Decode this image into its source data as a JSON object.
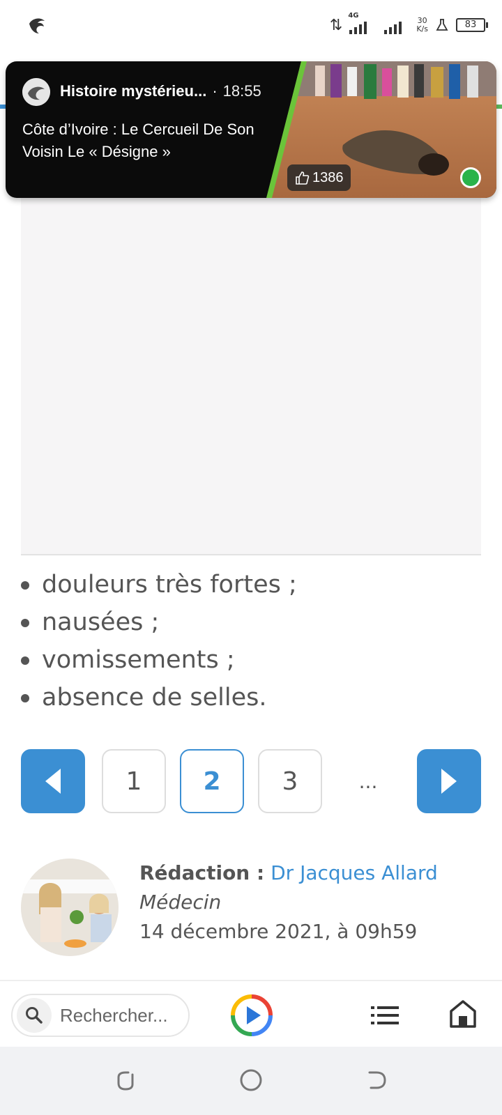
{
  "status_bar": {
    "network_type": "4G",
    "speed_value": "30",
    "speed_unit": "K/s",
    "battery": "83",
    "icons": [
      "app-bird-icon",
      "data-arrows-icon",
      "signal-icon",
      "flask-icon",
      "battery-icon"
    ]
  },
  "notification": {
    "app_name": "Histoire mystérieu...",
    "separator": "·",
    "time": "18:55",
    "message": "Côte d’Ivoire : Le Cercueil De Son Voisin Le « Désigne »",
    "likes": "1386",
    "accent": "#6bc43a"
  },
  "article": {
    "bullets": [
      "douleurs très fortes ;",
      "nausées ;",
      "vomissements ;",
      "absence de selles."
    ]
  },
  "pagination": {
    "pages": [
      "1",
      "2",
      "3"
    ],
    "current": "2",
    "ellipsis": "...",
    "accent": "#3b8fd3"
  },
  "author": {
    "label": "Rédaction :",
    "name": "Dr Jacques Allard",
    "role": "Médecin",
    "date": "14 décembre 2021, à 09h59"
  },
  "bottom_bar": {
    "search_placeholder": "Rechercher...",
    "icons": [
      "search-icon",
      "play-icon",
      "list-icon",
      "home-icon"
    ]
  },
  "colors": {
    "link": "#3b8fd3",
    "text": "#555555",
    "nav_bg": "#f1f2f4"
  }
}
